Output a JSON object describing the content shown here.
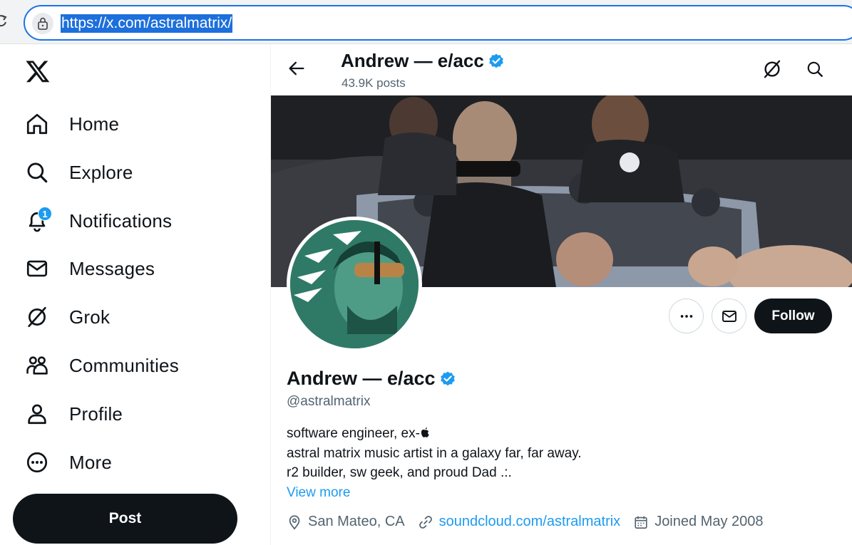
{
  "browser": {
    "url": "https://x.com/astralmatrix/"
  },
  "sidebar": {
    "items": [
      {
        "label": "Home",
        "icon": "home-icon"
      },
      {
        "label": "Explore",
        "icon": "search-icon"
      },
      {
        "label": "Notifications",
        "icon": "bell-icon",
        "badge": "1"
      },
      {
        "label": "Messages",
        "icon": "envelope-icon"
      },
      {
        "label": "Grok",
        "icon": "grok-icon"
      },
      {
        "label": "Communities",
        "icon": "people-icon"
      },
      {
        "label": "Profile",
        "icon": "person-icon"
      },
      {
        "label": "More",
        "icon": "more-circle-icon"
      }
    ],
    "post_label": "Post"
  },
  "header": {
    "name": "Andrew — e/acc",
    "post_count": "43.9K posts"
  },
  "profile": {
    "name": "Andrew — e/acc",
    "handle": "@astralmatrix",
    "bio_lines": [
      "software engineer, ex-",
      "astral matrix music artist in a galaxy far, far away.",
      "r2 builder, sw geek, and proud Dad .:."
    ],
    "view_more": "View more",
    "location": "San Mateo, CA",
    "website": "soundcloud.com/astralmatrix",
    "joined": "Joined May 2008",
    "follow_label": "Follow"
  },
  "colors": {
    "accent": "#1d9bf0",
    "text": "#0f1419",
    "muted": "#536471",
    "dark_button": "#0f1419"
  }
}
